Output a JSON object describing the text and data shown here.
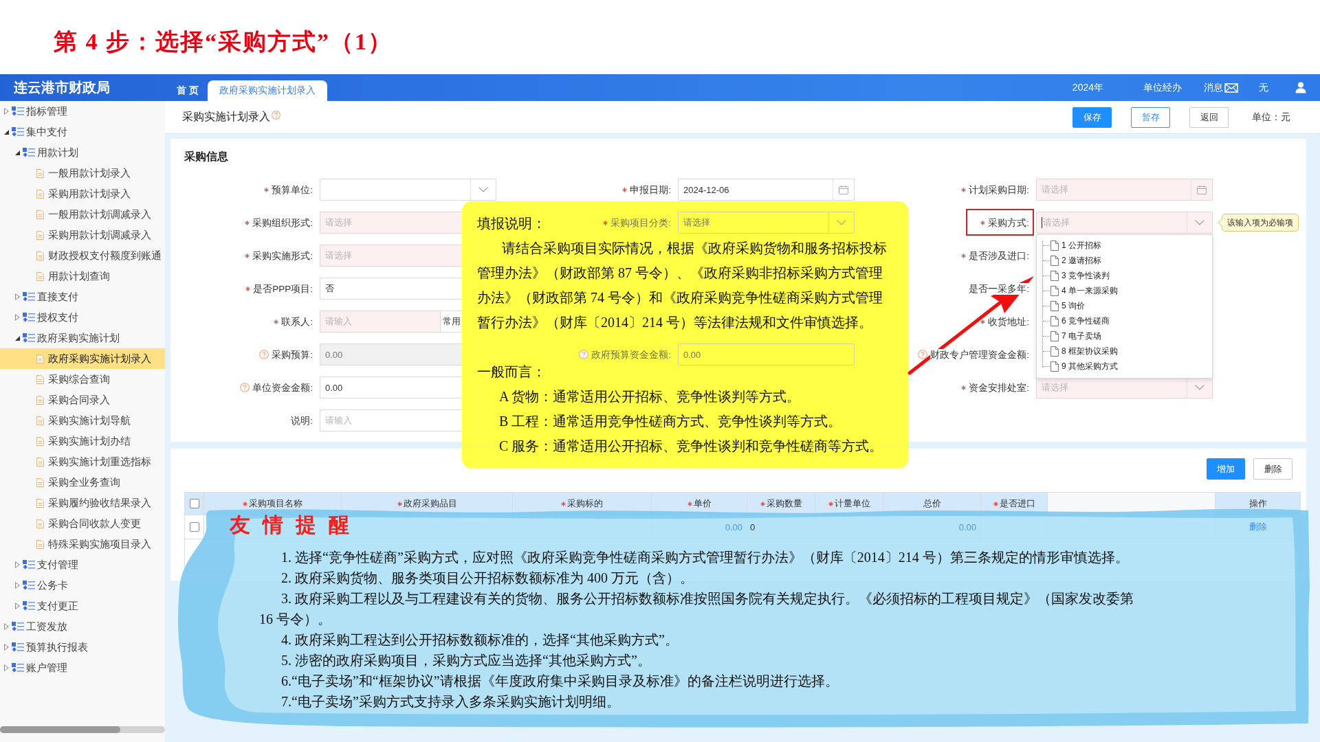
{
  "step_title": "第 4 步：选择“采购方式”（1）",
  "header": {
    "title": "连云港市财政局",
    "tabs": [
      {
        "label": "首 页",
        "selected": false
      },
      {
        "label": "政府采购实施计划录入",
        "selected": true
      }
    ],
    "year": "2024年",
    "role": "单位经办",
    "messages": "消息",
    "user": "无"
  },
  "sidebar": {
    "items": [
      {
        "label": "指标管理",
        "kind": "folder",
        "expanded": false,
        "selected": false
      },
      {
        "label": "集中支付",
        "kind": "folder",
        "expanded": true,
        "selected": false,
        "children": [
          {
            "label": "用款计划",
            "kind": "folder",
            "expanded": true,
            "selected": false,
            "children": [
              {
                "label": "一般用款计划录入",
                "kind": "page",
                "selected": false
              },
              {
                "label": "采购用款计划录入",
                "kind": "page",
                "selected": false
              },
              {
                "label": "一般用款计划调减录入",
                "kind": "page",
                "selected": false
              },
              {
                "label": "采购用款计划调减录入",
                "kind": "page",
                "selected": false
              },
              {
                "label": "财政授权支付额度到账通",
                "kind": "page",
                "selected": false
              },
              {
                "label": "用款计划查询",
                "kind": "page",
                "selected": false
              }
            ]
          },
          {
            "label": "直接支付",
            "kind": "folder",
            "expanded": false,
            "selected": false
          },
          {
            "label": "授权支付",
            "kind": "folder",
            "expanded": false,
            "selected": false
          },
          {
            "label": "政府采购实施计划",
            "kind": "folder",
            "expanded": true,
            "selected": false,
            "children": [
              {
                "label": "政府采购实施计划录入",
                "kind": "page",
                "selected": true
              },
              {
                "label": "采购综合查询",
                "kind": "page",
                "selected": false
              },
              {
                "label": "采购合同录入",
                "kind": "page",
                "selected": false
              },
              {
                "label": "采购实施计划导航",
                "kind": "page",
                "selected": false
              },
              {
                "label": "采购实施计划办结",
                "kind": "page",
                "selected": false
              },
              {
                "label": "采购实施计划重选指标",
                "kind": "page",
                "selected": false
              },
              {
                "label": "采购全业务查询",
                "kind": "page",
                "selected": false
              },
              {
                "label": "采购履约验收结果录入",
                "kind": "page",
                "selected": false
              },
              {
                "label": "采购合同收款人变更",
                "kind": "page",
                "selected": false
              },
              {
                "label": "特殊采购实施项目录入",
                "kind": "page",
                "selected": false
              }
            ]
          },
          {
            "label": "支付管理",
            "kind": "folder",
            "expanded": false,
            "selected": false
          },
          {
            "label": "公务卡",
            "kind": "folder",
            "expanded": false,
            "selected": false
          },
          {
            "label": "支付更正",
            "kind": "folder",
            "expanded": false,
            "selected": false
          }
        ]
      },
      {
        "label": "工资发放",
        "kind": "folder",
        "expanded": false,
        "selected": false
      },
      {
        "label": "预算执行报表",
        "kind": "folder",
        "expanded": false,
        "selected": false
      },
      {
        "label": "账户管理",
        "kind": "folder",
        "expanded": false,
        "selected": false
      }
    ]
  },
  "page": {
    "title": "采购实施计划录入",
    "help": true,
    "buttons": [
      {
        "label": "保存",
        "kind": "save"
      },
      {
        "label": "暂存",
        "kind": "draft"
      },
      {
        "label": "返回",
        "kind": "back"
      }
    ],
    "unit": "单位：元"
  },
  "form": {
    "title": "采购信息",
    "rows": [
      {
        "left": {
          "label": "预算单位:",
          "required": true,
          "help": false,
          "kind": "select",
          "invalid": false,
          "disabled": false
        },
        "middle": {
          "label": "申报日期:",
          "required": true,
          "help": false,
          "kind": "date",
          "value": "2024-12-06",
          "invalid": false,
          "disabled": false
        },
        "right": {
          "label": "计划采购日期:",
          "required": true,
          "help": false,
          "kind": "date",
          "placeholder": "请选择",
          "invalid": true,
          "disabled": false
        }
      },
      {
        "left": {
          "label": "采购组织形式:",
          "required": true,
          "help": false,
          "kind": "select",
          "placeholder": "请选择",
          "invalid": true,
          "disabled": false
        },
        "middle": {
          "label": "采购项目分类:",
          "required": true,
          "help": false,
          "kind": "select",
          "placeholder": "请选择",
          "invalid": true,
          "disabled": false
        },
        "right": {
          "label": "采购方式:",
          "required": true,
          "help": false,
          "kind": "select",
          "placeholder": "请选择",
          "invalid": true,
          "disabled": false,
          "focused": true,
          "highlighted": true,
          "tooltip": "该输入项为必输项",
          "open": true,
          "options": [
            {
              "label": "1 公开招标",
              "selected": false
            },
            {
              "label": "2 邀请招标",
              "selected": false
            },
            {
              "label": "3 竞争性谈判",
              "selected": false
            },
            {
              "label": "4 单一来源采购",
              "selected": false
            },
            {
              "label": "5 询价",
              "selected": false
            },
            {
              "label": "6 竞争性磋商",
              "selected": false
            },
            {
              "label": "7 电子卖场",
              "selected": false
            },
            {
              "label": "8 框架协议采购",
              "selected": false
            },
            {
              "label": "9 其他采购方式",
              "selected": false
            }
          ]
        }
      },
      {
        "left": {
          "label": "采购实施形式:",
          "required": true,
          "help": false,
          "kind": "select",
          "placeholder": "请选择",
          "invalid": true,
          "disabled": false
        },
        "right": {
          "label": "是否涉及进口:",
          "required": true,
          "help": false,
          "kind": "covered"
        }
      },
      {
        "left": {
          "label": "是否PPP项目:",
          "required": true,
          "help": false,
          "kind": "select",
          "value": "否",
          "invalid": false,
          "disabled": false
        },
        "right": {
          "label": "是否一采多年:",
          "required": false,
          "help": false,
          "kind": "covered"
        }
      },
      {
        "left": {
          "label": "联系人:",
          "required": true,
          "help": false,
          "kind": "lookup",
          "placeholder": "请输入",
          "addon": "常用",
          "invalid": true,
          "disabled": false
        },
        "right": {
          "label": "收货地址:",
          "required": true,
          "help": false,
          "kind": "covered"
        }
      },
      {
        "left": {
          "label": "采购预算:",
          "required": false,
          "help": true,
          "kind": "text",
          "value": "0.00",
          "invalid": false,
          "disabled": true
        },
        "middle": {
          "label": "政府预算资金金额:",
          "required": false,
          "help": true,
          "kind": "text",
          "value": "0.00",
          "invalid": false,
          "disabled": false
        },
        "right": {
          "label": "财政专户管理资金金额:",
          "required": false,
          "help": true,
          "kind": "covered"
        }
      },
      {
        "left": {
          "label": "单位资金金额:",
          "required": false,
          "help": true,
          "kind": "text",
          "value": "0.00",
          "invalid": false,
          "disabled": false
        },
        "right": {
          "label": "资金安排处室:",
          "required": true,
          "help": false,
          "kind": "select",
          "placeholder": "请选择",
          "invalid": true,
          "disabled": false
        }
      },
      {
        "left": {
          "label": "说明:",
          "required": false,
          "help": false,
          "kind": "text",
          "placeholder": "请输入",
          "invalid": false,
          "disabled": false
        }
      }
    ]
  },
  "guide": {
    "title": "填报说明：",
    "body": "请结合采购项目实际情况，根据《政府采购货物和服务招标投标管理办法》（财政部第 87 号令）、《政府采购非招标采购方式管理办法》（财政部第 74 号令）和《政府采购竞争性磋商采购方式管理暂行办法》（财库〔2014〕214 号）等法律法规和文件审慎选择。",
    "summary_title": "一般而言：",
    "summary": [
      "A 货物：通常适用公开招标、竞争性谈判等方式。",
      "B 工程：通常适用竞争性磋商方式、竞争性谈判等方式。",
      "C 服务：通常适用公开招标、竞争性谈判和竞争性磋商等方式。"
    ]
  },
  "items": {
    "buttons": [
      {
        "label": "增加",
        "kind": "add"
      },
      {
        "label": "删除",
        "kind": "delete"
      }
    ],
    "select_all": false,
    "columns": [
      {
        "label": "采购项目名称",
        "required": true
      },
      {
        "label": "政府采购品目",
        "required": true
      },
      {
        "label": "采购标的",
        "required": true
      },
      {
        "label": "单价",
        "required": true
      },
      {
        "label": "采购数量",
        "required": true
      },
      {
        "label": "计量单位",
        "required": true
      },
      {
        "label": "总价",
        "required": false
      },
      {
        "label": "是否进口",
        "required": true
      }
    ],
    "action_header": "操作",
    "rows": [
      {
        "checked": false,
        "unit_price": "0.00",
        "quantity": "0",
        "total": "0.00",
        "action": "删除"
      }
    ]
  },
  "reminder": {
    "title": "友情提醒",
    "items": [
      "1. 选择“竞争性磋商”采购方式，应对照《政府采购竞争性磋商采购方式管理暂行办法》（财库〔2014〕214 号）第三条规定的情形审慎选择。",
      "2. 政府采购货物、服务类项目公开招标数额标准为 400 万元（含）。",
      "3. 政府采购工程以及与工程建设有关的货物、服务公开招标数额标准按照国务院有关规定执行。《必须招标的工程项目规定》（国家发改委第 16 号令）。",
      "4. 政府采购工程达到公开招标数额标准的，选择“其他采购方式”。",
      "5. 涉密的政府采购项目，采购方式应当选择“其他采购方式”。",
      "6.“电子卖场”和“框架协议”请根据《年度政府集中采购目录及标准》的备注栏说明进行选择。",
      "7.“电子卖场”采购方式支持录入多条采购实施计划明细。"
    ]
  }
}
